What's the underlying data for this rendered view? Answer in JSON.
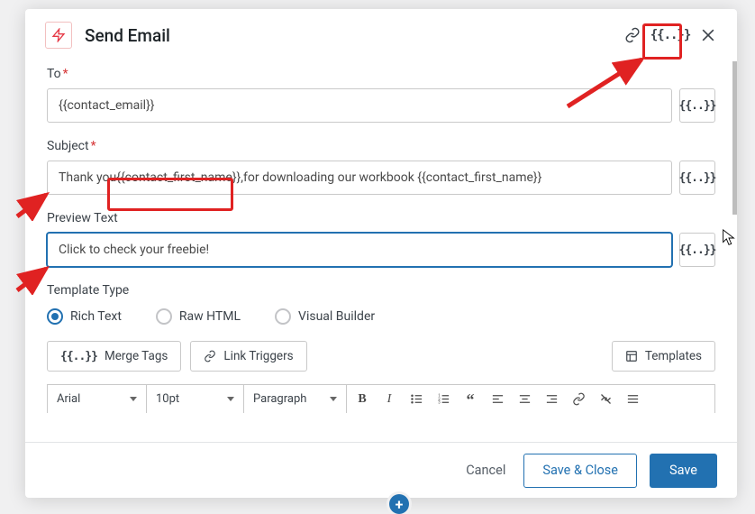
{
  "header": {
    "title": "Send Email"
  },
  "fields": {
    "to": {
      "label": "To",
      "value": "{{contact_email}}"
    },
    "subject": {
      "label": "Subject",
      "pre": "Thank you ",
      "token": "{{contact_first_name}},",
      "post": " for downloading our workbook {{contact_first_name}}"
    },
    "preview": {
      "label": "Preview Text",
      "value": "Click to check your freebie!"
    },
    "template_type": {
      "label": "Template Type",
      "options": {
        "rich": "Rich Text",
        "raw": "Raw HTML",
        "visual": "Visual Builder"
      }
    }
  },
  "toolbar": {
    "merge_tags": "Merge Tags",
    "link_triggers": "Link Triggers",
    "templates": "Templates"
  },
  "editor": {
    "font": "Arial",
    "size": "10pt",
    "block": "Paragraph"
  },
  "footer": {
    "cancel": "Cancel",
    "save_close": "Save & Close",
    "save": "Save"
  },
  "glyphs": {
    "merge": "{{..}}"
  }
}
